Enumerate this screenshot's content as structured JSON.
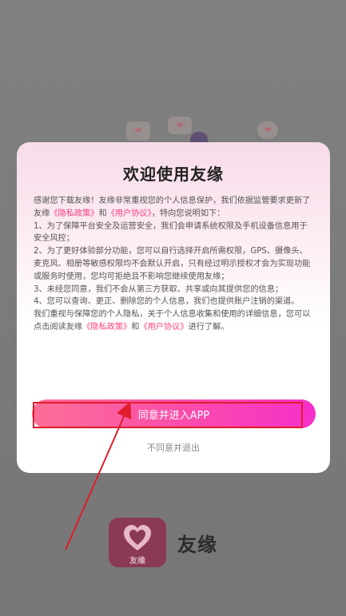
{
  "dialog": {
    "title": "欢迎使用友缘",
    "intro_prefix": "感谢您下载友缘！友缘非常重视您的个人信息保护，我们依据监管要求更新了友缘",
    "privacy_link": "《隐私政策》",
    "and": "和",
    "user_agreement_link": "《用户协议》",
    "intro_suffix": "，特向您说明如下：",
    "item1": "1、为了保障平台安全及运营安全，我们会申请系统权限及手机设备信息用于安全风控；",
    "item2": "2、为了更好体验部分功能，您可以自行选择开启所需权限，GPS、摄像头、麦克风、相册等敏感权限均不会默认开启，只有经过明示授权才会为实现功能或服务时使用，您均可拒绝且不影响您继续使用友缘；",
    "item3": "3、未经您同意，我们不会从第三方获取、共享或向其提供您的信息；",
    "item4": "4、您可以查询、更正、删除您的个人信息，我们也提供账户注销的渠道。",
    "outro_prefix": "我们重视与保障您的个人隐私，关于个人信息收集和使用的详细信息，您可以点击阅读友缘",
    "outro_suffix": "进行了解。",
    "agree_label": "同意并进入APP",
    "decline_label": "不同意并退出"
  },
  "brand": {
    "app_name": "友缘",
    "logo_sub": "友缘"
  },
  "colors": {
    "accent": "#ff3d7f",
    "button_start": "#fb6f97",
    "button_end": "#f52fc9",
    "annotation": "#e11c2c"
  }
}
